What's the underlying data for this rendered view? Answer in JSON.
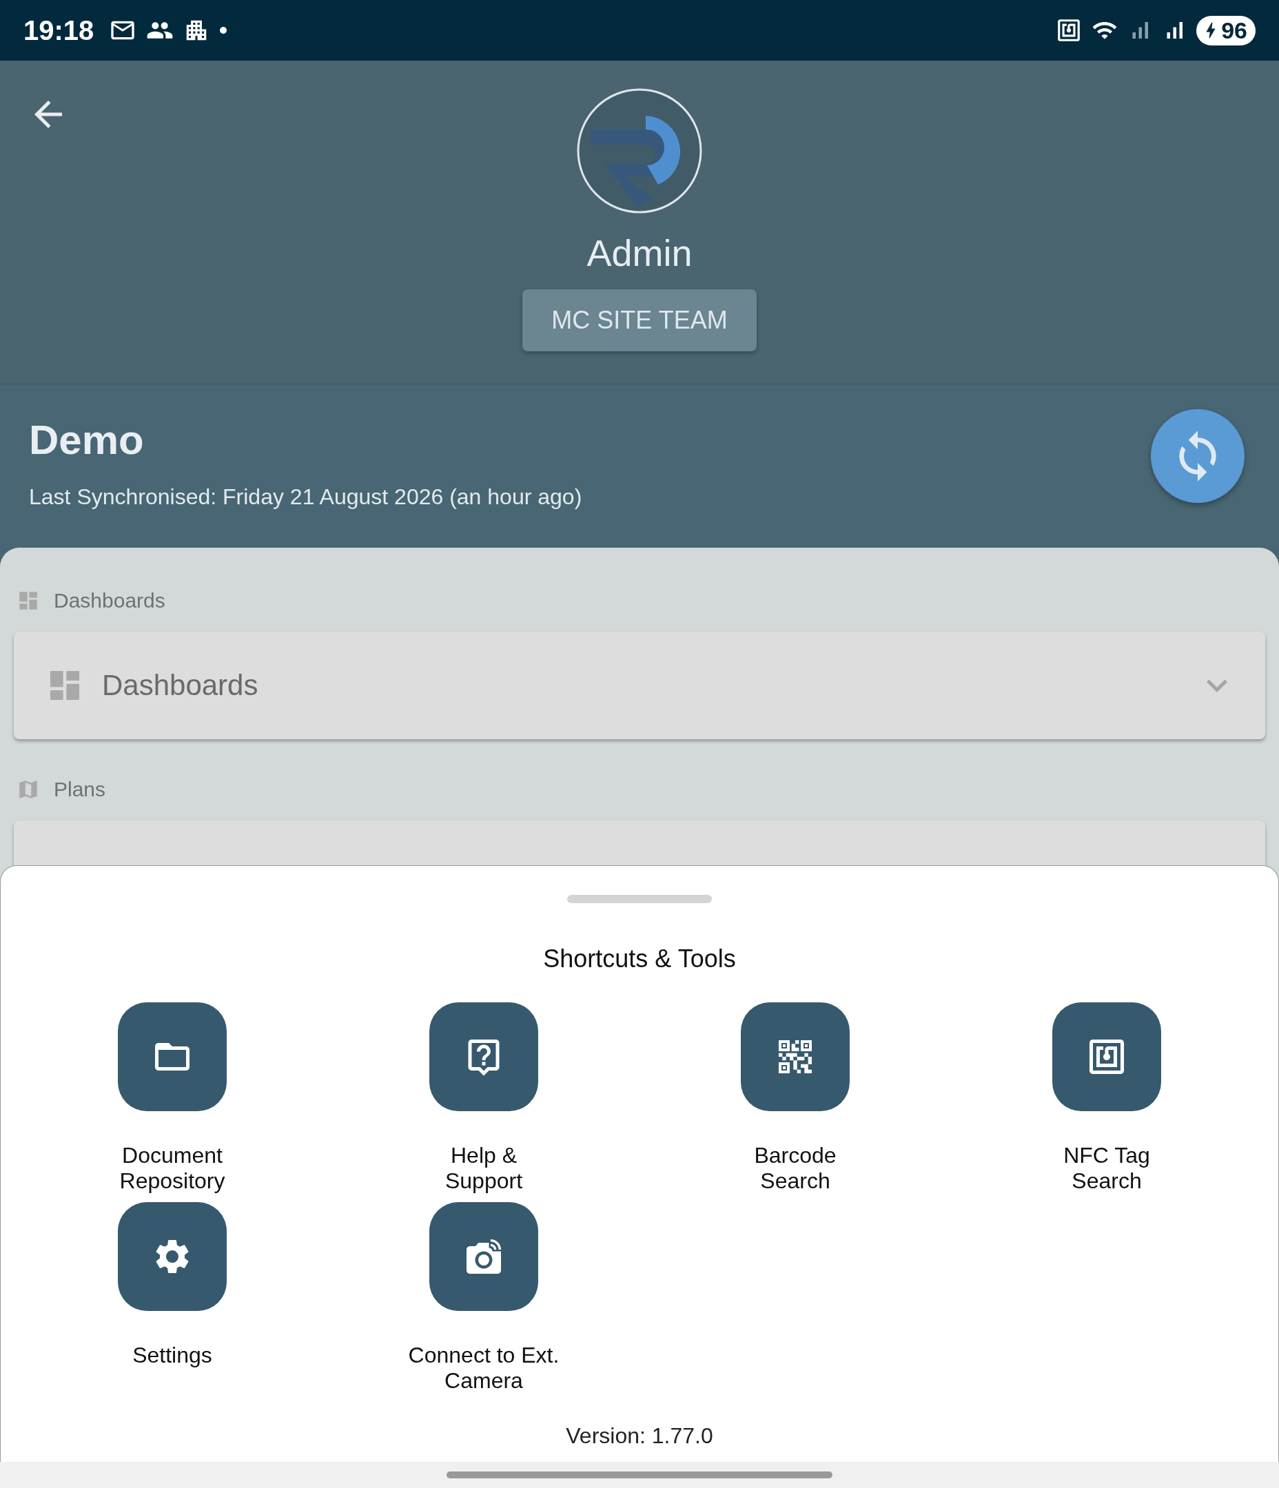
{
  "status_bar": {
    "time": "19:18",
    "battery": "96"
  },
  "profile": {
    "name": "Admin",
    "team": "MC SITE TEAM"
  },
  "site": {
    "name": "Demo",
    "last_sync": "Last Synchronised: Friday 21 August 2026 (an hour ago)"
  },
  "sections": [
    {
      "kind": "dashboard",
      "label": "Dashboards",
      "card": "Dashboards"
    },
    {
      "kind": "plans",
      "label": "Plans"
    }
  ],
  "sheet": {
    "title": "Shortcuts & Tools",
    "tools": [
      {
        "kind": "folder",
        "label": "Document\nRepository"
      },
      {
        "kind": "help",
        "label": "Help &\nSupport"
      },
      {
        "kind": "qr",
        "label": "Barcode\nSearch"
      },
      {
        "kind": "nfc",
        "label": "NFC Tag\nSearch"
      },
      {
        "kind": "settings",
        "label": "Settings"
      },
      {
        "kind": "camera",
        "label": "Connect to Ext.\nCamera"
      }
    ],
    "version": "Version: 1.77.0"
  }
}
